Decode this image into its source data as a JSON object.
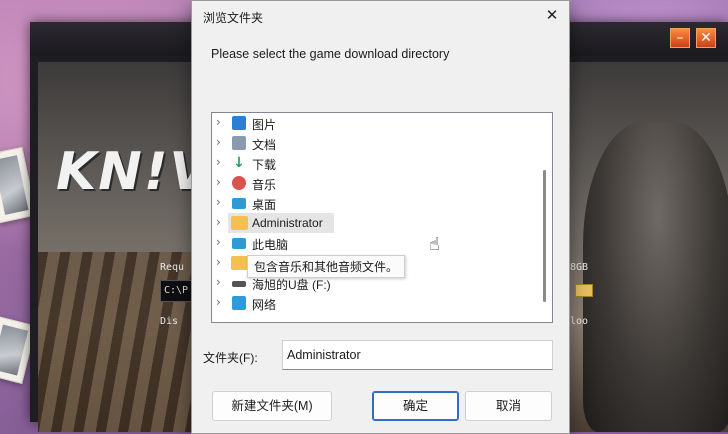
{
  "background": {
    "logo_text": "KN!V",
    "req_left": "Requ",
    "req_right": "8GB",
    "path_value": "C:\\P",
    "disk_left": "Dis",
    "disk_right": "loo"
  },
  "installer_window": {
    "minimize_glyph": "–",
    "close_glyph": "✕"
  },
  "dialog": {
    "title": "浏览文件夹",
    "close_glyph": "✕",
    "prompt": "Please select the game download directory",
    "tree": [
      {
        "label": "图片",
        "icon": "pictures-icon",
        "color": "#2a7fd4"
      },
      {
        "label": "文档",
        "icon": "documents-icon",
        "color": "#8a9bb0"
      },
      {
        "label": "下载",
        "icon": "downloads-icon",
        "color": "#1f9e5a"
      },
      {
        "label": "音乐",
        "icon": "music-icon",
        "color": "#d9534f"
      },
      {
        "label": "桌面",
        "icon": "desktop-icon",
        "color": "#2d9bd6"
      },
      {
        "label": "Administrator",
        "icon": "user-folder-icon",
        "color": "#f2c14e"
      },
      {
        "label": "此电脑",
        "icon": "this-pc-icon",
        "color": "#2d9bd6"
      },
      {
        "label": "",
        "icon": "folder-icon",
        "color": "#f2c14e"
      },
      {
        "label": "海旭的U盘 (F:)",
        "icon": "usb-drive-icon",
        "color": "#555555"
      },
      {
        "label": "网络",
        "icon": "network-icon",
        "color": "#2d9bd6"
      }
    ],
    "tooltip": "包含音乐和其他音频文件。",
    "folder_label": "文件夹(F):",
    "folder_value": "Administrator",
    "buttons": {
      "new_folder": "新建文件夹(M)",
      "ok": "确定",
      "cancel": "取消"
    },
    "chevron": "›"
  }
}
